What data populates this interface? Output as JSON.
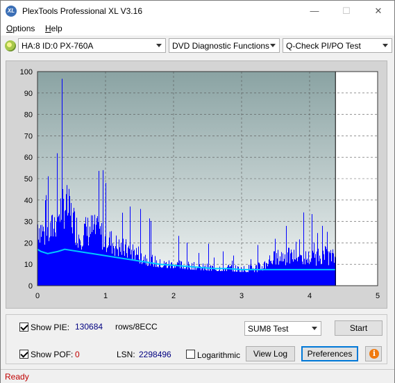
{
  "window": {
    "title": "PlexTools Professional XL V3.16",
    "app_icon": "XL",
    "minimize_glyph": "—",
    "maximize_glyph": "☐",
    "close_glyph": "✕"
  },
  "menu": {
    "items": [
      {
        "label": "Options",
        "accel": "O",
        "rest": "ptions"
      },
      {
        "label": "Help",
        "accel": "H",
        "rest": "elp"
      }
    ]
  },
  "toolbar": {
    "drive": "HA:8 ID:0  PX-760A",
    "function": "DVD Diagnostic Functions",
    "test": "Q-Check PI/PO Test"
  },
  "chart_data": {
    "type": "bar",
    "xlim": [
      0,
      5
    ],
    "ylim": [
      0,
      100
    ],
    "xticks": [
      "0",
      "1",
      "2",
      "3",
      "4",
      "5"
    ],
    "yticks": [
      "100",
      "90",
      "80",
      "70",
      "60",
      "50",
      "40",
      "30",
      "20",
      "10",
      "0"
    ],
    "data_end_x": 4.38,
    "grid": true,
    "series": [
      {
        "color": "#0000ff",
        "type": "bars",
        "x": [
          0.0,
          0.1,
          0.2,
          0.3,
          0.4,
          0.5,
          0.6,
          0.8,
          1.0,
          1.2,
          1.4,
          1.6,
          1.8,
          2.0,
          2.2,
          2.4,
          2.6,
          2.8,
          3.0,
          3.2,
          3.3,
          3.4,
          3.6,
          3.8,
          4.0,
          4.2,
          4.38
        ],
        "values": [
          36,
          30,
          32,
          42,
          48,
          40,
          30,
          33,
          28,
          22,
          20,
          16,
          12,
          12,
          11,
          10,
          10,
          10,
          9,
          10,
          11,
          15,
          17,
          17,
          16,
          18,
          16
        ]
      },
      {
        "color": "#00c8ff",
        "type": "line",
        "x": [
          0.0,
          0.05,
          0.15,
          0.3,
          0.4,
          0.6,
          0.8,
          1.0,
          1.2,
          1.4,
          1.6,
          1.8,
          2.0,
          2.2,
          2.4,
          2.6,
          2.8,
          3.0,
          3.2,
          3.4,
          3.6,
          3.8,
          4.0,
          4.2,
          4.38
        ],
        "values": [
          17,
          16,
          15,
          16,
          17,
          16,
          15,
          14,
          13,
          12,
          11,
          10,
          9.5,
          9,
          8.5,
          8,
          8,
          7.5,
          7.5,
          7.5,
          7.5,
          7.5,
          7.5,
          7.5,
          7.5
        ]
      }
    ]
  },
  "bottom": {
    "show_pie_label": "Show PIE:",
    "pie_value": "130684",
    "pie_unit": "rows/8ECC",
    "show_pof_label": "Show POF:",
    "pof_value": "0",
    "lsn_label": "LSN:",
    "lsn_value": "2298496",
    "logarithmic_label": "Logarithmic",
    "test_select": "SUM8 Test",
    "start_label": "Start",
    "view_log_label": "View Log",
    "preferences_label": "Preferences",
    "info_glyph": "i"
  },
  "status": {
    "text": "Ready"
  }
}
